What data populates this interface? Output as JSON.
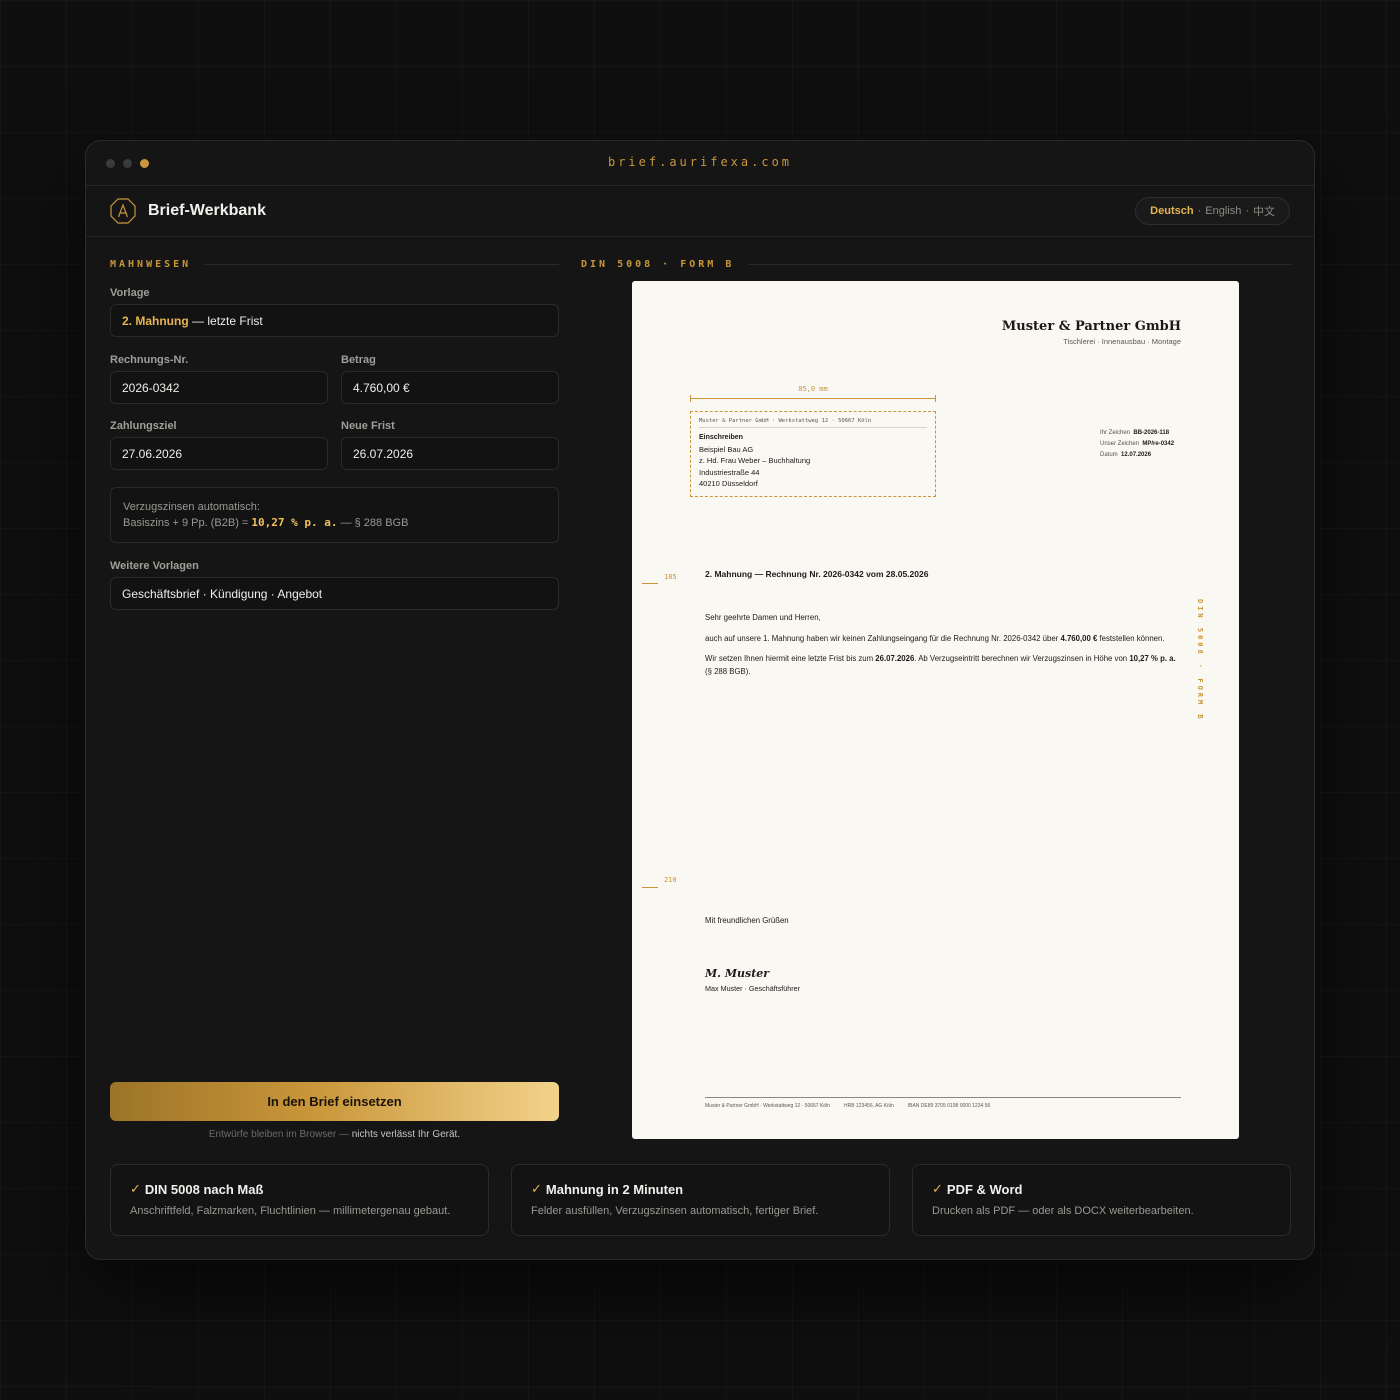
{
  "browser": {
    "url": "brief.aurifexa.com"
  },
  "app": {
    "title": "Brief-Werkbank"
  },
  "languages": {
    "active": "Deutsch",
    "sep1": "·",
    "second": "English",
    "sep2": "·",
    "third": "中文"
  },
  "form": {
    "section": "MAHNWESEN",
    "vorlage_label": "Vorlage",
    "vorlage_value_strong": "2. Mahnung",
    "vorlage_value_rest": "— letzte Frist",
    "rechnung_label": "Rechnungs-Nr.",
    "rechnung_value": "2026-0342",
    "betrag_label": "Betrag",
    "betrag_value": "4.760,00 €",
    "zahlungsziel_label": "Zahlungsziel",
    "zahlungsziel_value": "27.06.2026",
    "frist_label": "Neue Frist",
    "frist_value": "26.07.2026",
    "zinsen_line1": "Verzugszinsen automatisch:",
    "zinsen_prefix": "Basiszins + 9 Pp. (B2B) =",
    "zinsen_rate": "10,27 % p. a.",
    "zinsen_suffix": "— § 288 BGB",
    "weitere_label": "Weitere Vorlagen",
    "weitere_value": "Geschäftsbrief · Kündigung · Angebot",
    "cta_label": "In den Brief einsetzen",
    "hint_prefix": "Entwürfe bleiben im Browser —",
    "hint_strong": "nichts verlässt Ihr Gerät."
  },
  "preview": {
    "section": "DIN 5008 · FORM B",
    "company_name": "Muster & Partner GmbH",
    "company_sub": "Tischlerei · Innenausbau · Montage",
    "measure": "85,0 mm",
    "sender_line": "Muster & Partner GmbH · Werkstattweg 12 · 50667 Köln",
    "mode": "Einschreiben",
    "recipient": [
      "Beispiel Bau AG",
      "z. Hd. Frau Weber – Buchhaltung",
      "Industriestraße 44",
      "40210 Düsseldorf"
    ],
    "refs": [
      {
        "label": "Ihr Zeichen",
        "value": "BB-2026-118"
      },
      {
        "label": "Unser Zeichen",
        "value": "MP/re-0342"
      },
      {
        "label": "Datum",
        "value": "12.07.2026"
      }
    ],
    "fold1": "105",
    "fold2": "210",
    "subject": "2. Mahnung — Rechnung Nr. 2026-0342 vom 28.05.2026",
    "salutation": "Sehr geehrte Damen und Herren,",
    "p1_a": "auch auf unsere 1. Mahnung haben wir keinen Zahlungseingang für die Rechnung Nr. 2026-0342 über",
    "p1_b": "4.760,00 €",
    "p1_c": "feststellen können.",
    "p2_a": "Wir setzen Ihnen hiermit eine letzte Frist bis zum",
    "p2_b": "26.07.2026",
    "p2_c": ". Ab Verzugseintritt berechnen wir Verzugszinsen in Höhe von",
    "p2_d": "10,27 % p. a.",
    "p2_e": "(§ 288 BGB).",
    "vertical": "DIN 5008 · FORM B",
    "closing": "Mit freundlichen Grüßen",
    "signature": "M. Muster",
    "signer": "Max Muster · Geschäftsführer",
    "footer": [
      "Muster & Partner GmbH · Werkstattweg 12 · 50667 Köln",
      "HRB 123456, AG Köln",
      "IBAN DE89 3705 0198 0000 1234 56"
    ]
  },
  "features": [
    {
      "title": "DIN 5008 nach Maß",
      "desc": "Anschriftfeld, Falzmarken, Fluchtlinien — millimetergenau gebaut."
    },
    {
      "title": "Mahnung in 2 Minuten",
      "desc": "Felder ausfüllen, Verzugszinsen automatisch, fertiger Brief."
    },
    {
      "title": "PDF & Word",
      "desc": "Drucken als PDF — oder als DOCX weiterbearbeiten."
    }
  ],
  "colors": {
    "accent": "#c9963a",
    "accent_light": "#e6b450",
    "background": "#0f0f10",
    "paper": "#faf8f2"
  },
  "icons": {
    "logo": "octagon-a-logo-icon",
    "check": "check-icon"
  }
}
